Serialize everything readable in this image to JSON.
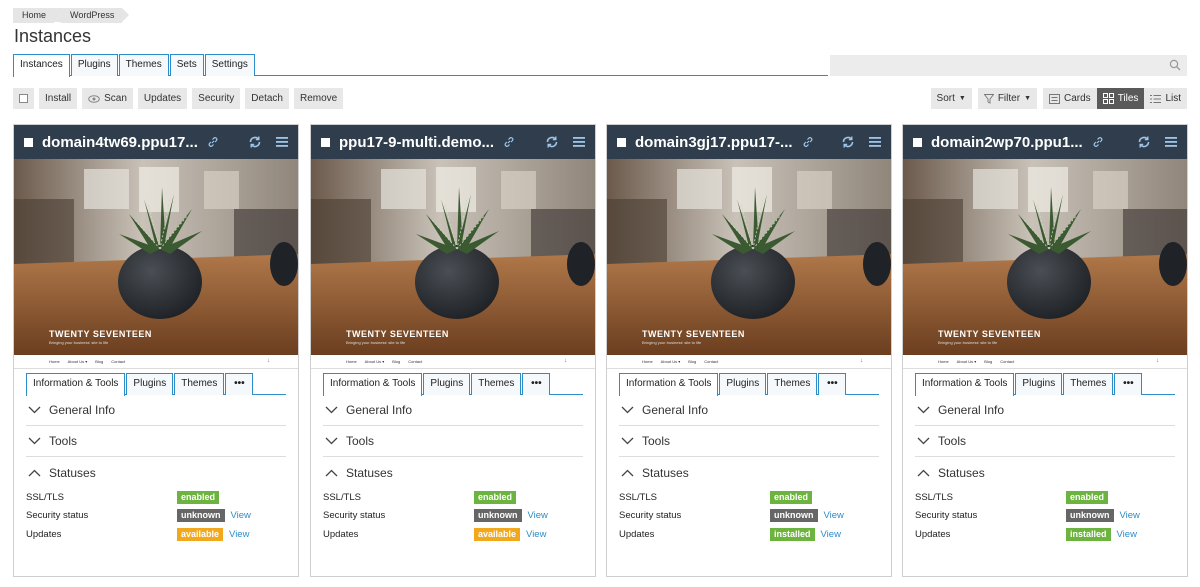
{
  "breadcrumb": [
    "Home",
    "WordPress"
  ],
  "page_title": "Instances",
  "main_tabs": [
    "Instances",
    "Plugins",
    "Themes",
    "Sets",
    "Settings"
  ],
  "toolbar": {
    "install": "Install",
    "scan": "Scan",
    "updates": "Updates",
    "security": "Security",
    "detach": "Detach",
    "remove": "Remove",
    "sort": "Sort",
    "filter": "Filter",
    "cards": "Cards",
    "tiles": "Tiles",
    "list": "List"
  },
  "colors": {
    "header": "#2f3d4c",
    "accent": "#2d8dc8",
    "enabled": "#6cb33f",
    "unknown": "#666666",
    "available": "#f2a81d"
  },
  "cards": [
    {
      "title": "domain4tw69.ppu17...",
      "site_name": "TWENTY SEVENTEEN",
      "site_tagline": "Bringing your business' site to life",
      "nav": [
        "Home",
        "About Us ▾",
        "Blog",
        "Contact"
      ],
      "tabs": [
        "Information & Tools",
        "Plugins",
        "Themes",
        "•••"
      ],
      "sections": [
        "General Info",
        "Tools",
        "Statuses"
      ],
      "statuses": [
        {
          "label": "SSL/TLS",
          "badge": "enabled",
          "view": ""
        },
        {
          "label": "Security status",
          "badge": "unknown",
          "view": "View"
        },
        {
          "label": "Updates",
          "badge": "available",
          "view": "View"
        }
      ]
    },
    {
      "title": "ppu17-9-multi.demo...",
      "site_name": "TWENTY SEVENTEEN",
      "site_tagline": "Bringing your business' site to life",
      "nav": [
        "Home",
        "About Us ▾",
        "Blog",
        "Contact"
      ],
      "tabs": [
        "Information & Tools",
        "Plugins",
        "Themes",
        "•••"
      ],
      "sections": [
        "General Info",
        "Tools",
        "Statuses"
      ],
      "statuses": [
        {
          "label": "SSL/TLS",
          "badge": "enabled",
          "view": ""
        },
        {
          "label": "Security status",
          "badge": "unknown",
          "view": "View"
        },
        {
          "label": "Updates",
          "badge": "available",
          "view": "View"
        }
      ]
    },
    {
      "title": "domain3gj17.ppu17-...",
      "site_name": "TWENTY SEVENTEEN",
      "site_tagline": "Bringing your business' site to life",
      "nav": [
        "Home",
        "About Us ▾",
        "Blog",
        "Contact"
      ],
      "tabs": [
        "Information & Tools",
        "Plugins",
        "Themes",
        "•••"
      ],
      "sections": [
        "General Info",
        "Tools",
        "Statuses"
      ],
      "statuses": [
        {
          "label": "SSL/TLS",
          "badge": "enabled",
          "view": ""
        },
        {
          "label": "Security status",
          "badge": "unknown",
          "view": "View"
        },
        {
          "label": "Updates",
          "badge": "installed",
          "view": "View"
        }
      ]
    },
    {
      "title": "domain2wp70.ppu1...",
      "site_name": "TWENTY SEVENTEEN",
      "site_tagline": "Bringing your business' site to life",
      "nav": [
        "Home",
        "About Us ▾",
        "Blog",
        "Contact"
      ],
      "tabs": [
        "Information & Tools",
        "Plugins",
        "Themes",
        "•••"
      ],
      "sections": [
        "General Info",
        "Tools",
        "Statuses"
      ],
      "statuses": [
        {
          "label": "SSL/TLS",
          "badge": "enabled",
          "view": ""
        },
        {
          "label": "Security status",
          "badge": "unknown",
          "view": "View"
        },
        {
          "label": "Updates",
          "badge": "installed",
          "view": "View"
        }
      ]
    }
  ]
}
